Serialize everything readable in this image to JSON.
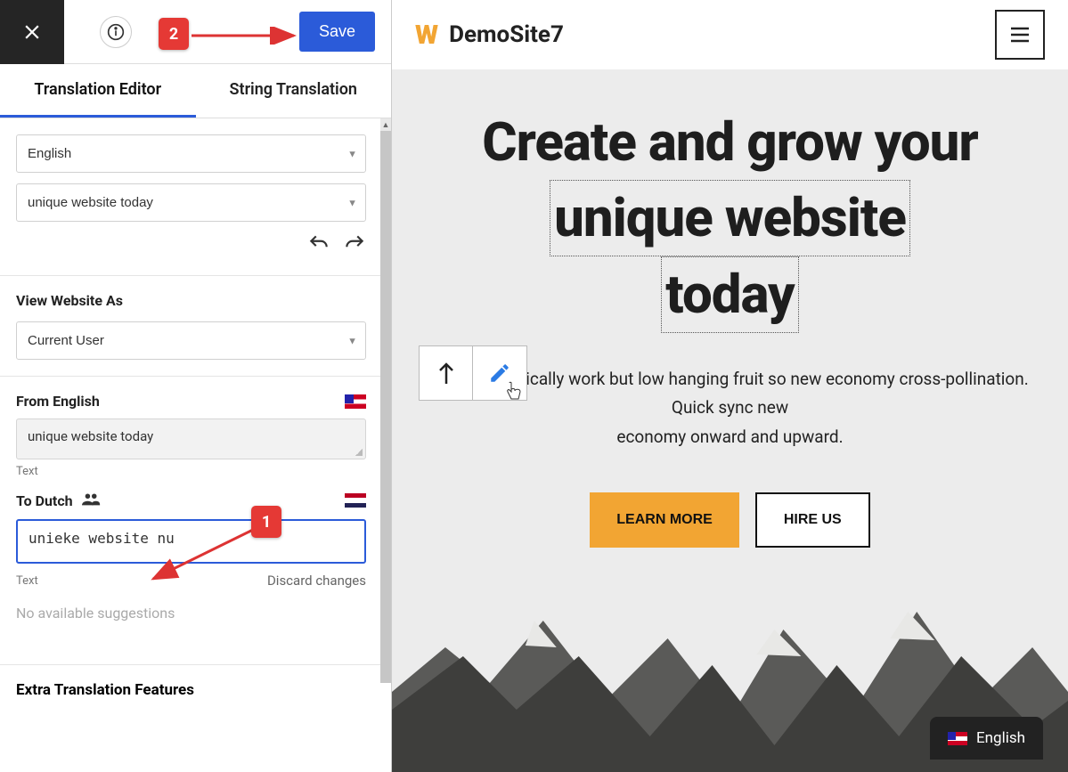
{
  "toolbar": {
    "save_label": "Save"
  },
  "tabs": {
    "translation_editor": "Translation Editor",
    "string_translation": "String Translation"
  },
  "selectors": {
    "language": "English",
    "string": "unique website today"
  },
  "view_as": {
    "label": "View Website As",
    "value": "Current User"
  },
  "from": {
    "label": "From English",
    "text": "unique website today",
    "caption": "Text"
  },
  "to": {
    "label": "To Dutch",
    "text": "unieke website nu",
    "caption": "Text",
    "discard": "Discard changes"
  },
  "suggestions_empty": "No available suggestions",
  "extra_title": "Extra Translation Features",
  "site": {
    "name": "DemoSite7"
  },
  "hero": {
    "line1": "Create and grow your",
    "line2_hl": "unique website",
    "line3_hl": "today",
    "sub1": "Programmatically work but low hanging fruit so new economy cross-pollination.",
    "sub2": "Quick sync new",
    "sub3": "economy onward and upward.",
    "cta_primary": "LEARN MORE",
    "cta_secondary": "HIRE US"
  },
  "lang_switcher": "English",
  "annotations": {
    "n1": "1",
    "n2": "2"
  }
}
